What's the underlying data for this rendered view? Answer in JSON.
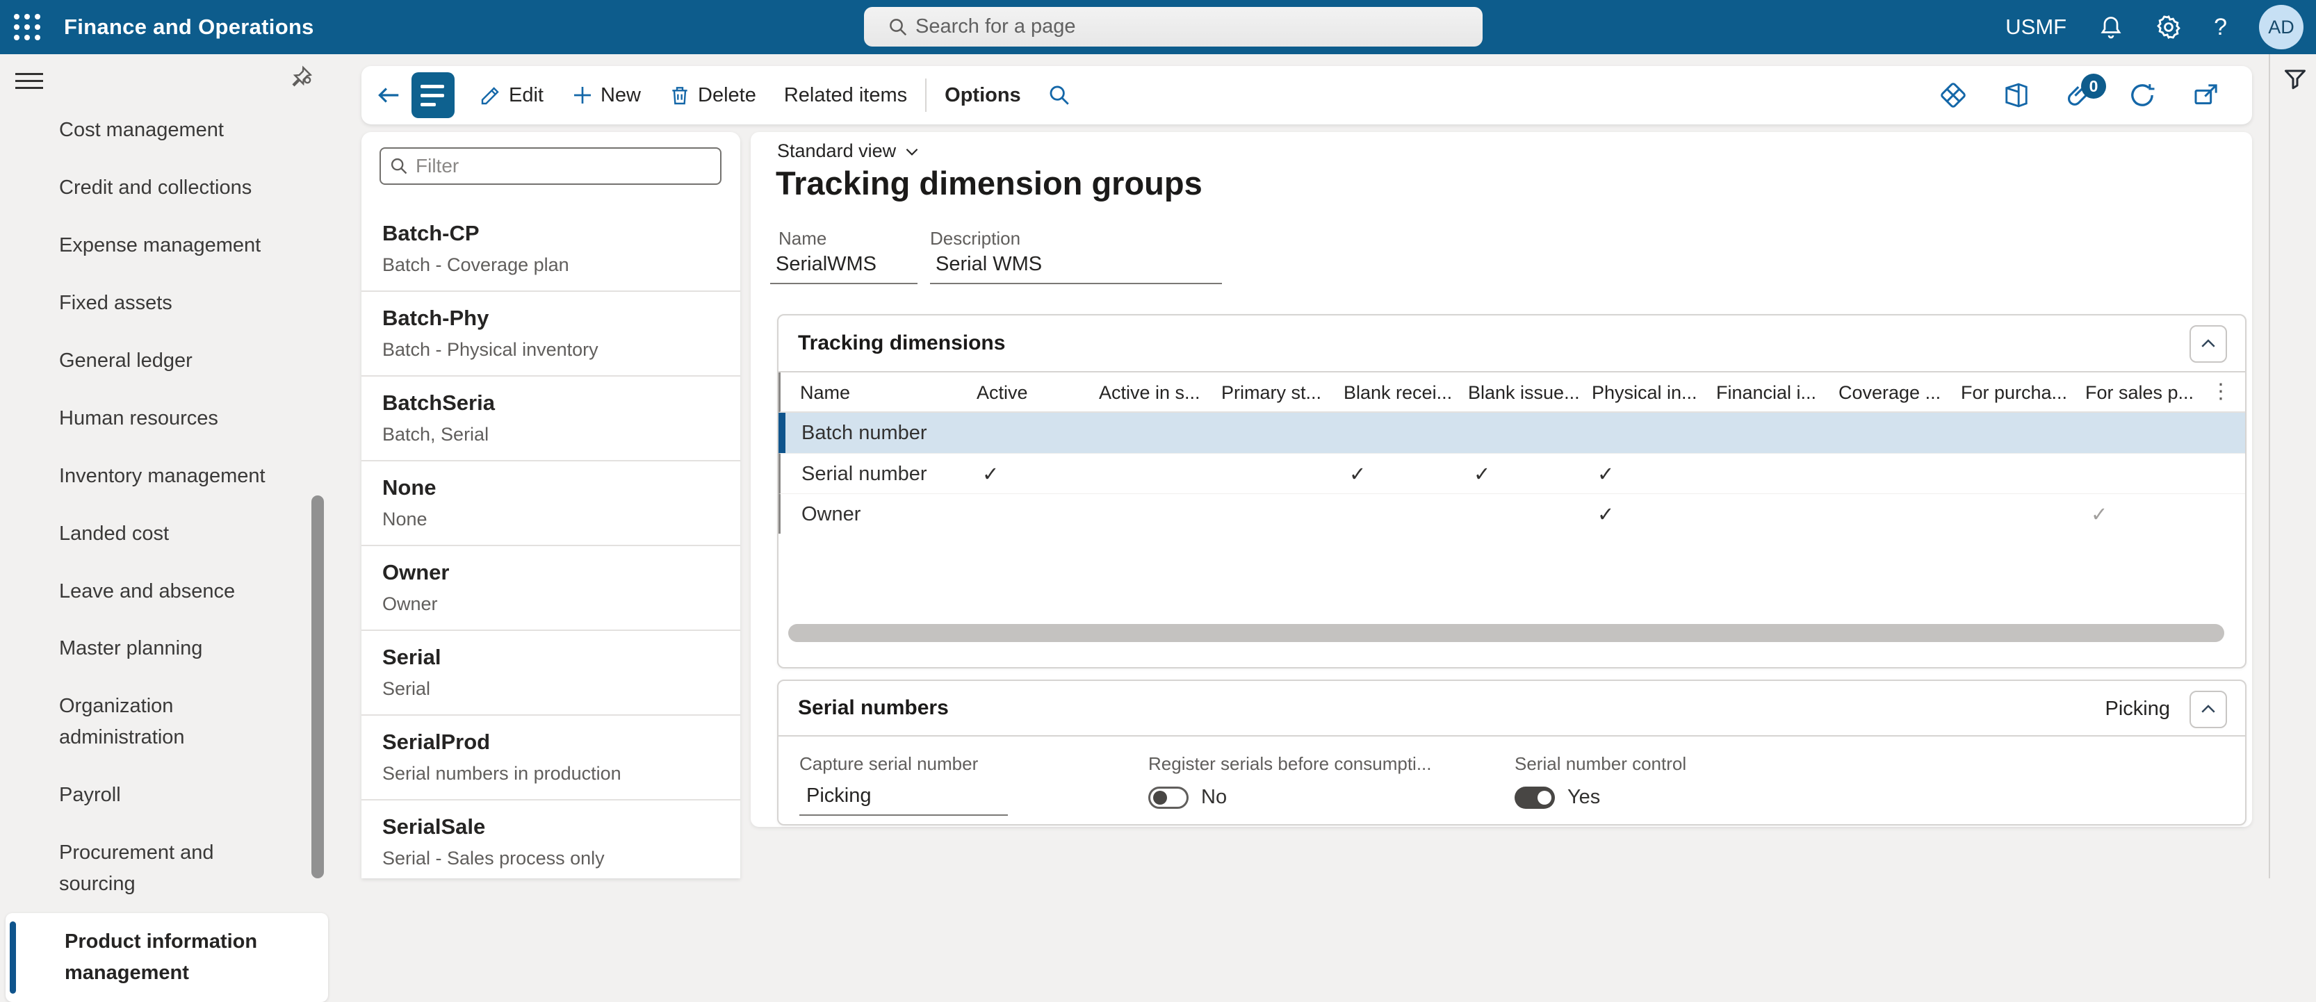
{
  "colors": {
    "topbar": "#0d5c8c",
    "accent": "#1467a8",
    "selected_row_bg": "#d3e2ee",
    "selected_row_bar": "#0f548c"
  },
  "topbar": {
    "app_title": "Finance and Operations",
    "search_placeholder": "Search for a page",
    "company": "USMF",
    "avatar_initials": "AD"
  },
  "action_bar": {
    "edit_label": "Edit",
    "new_label": "New",
    "delete_label": "Delete",
    "related_items_label": "Related items",
    "options_label": "Options",
    "attachments_badge": "0"
  },
  "nav": {
    "items": [
      {
        "label": "Cost management",
        "selected": false
      },
      {
        "label": "Credit and collections",
        "selected": false
      },
      {
        "label": "Expense management",
        "selected": false
      },
      {
        "label": "Fixed assets",
        "selected": false
      },
      {
        "label": "General ledger",
        "selected": false
      },
      {
        "label": "Human resources",
        "selected": false
      },
      {
        "label": "Inventory management",
        "selected": false
      },
      {
        "label": "Landed cost",
        "selected": false
      },
      {
        "label": "Leave and absence",
        "selected": false
      },
      {
        "label": "Master planning",
        "selected": false
      },
      {
        "label": "Organization administration",
        "selected": false
      },
      {
        "label": "Payroll",
        "selected": false
      },
      {
        "label": "Procurement and sourcing",
        "selected": false
      },
      {
        "label": "Product information management",
        "selected": true
      }
    ]
  },
  "record_list": {
    "filter_placeholder": "Filter",
    "items": [
      {
        "name": "Batch-CP",
        "description": "Batch - Coverage plan"
      },
      {
        "name": "Batch-Phy",
        "description": "Batch - Physical inventory"
      },
      {
        "name": "BatchSeria",
        "description": "Batch, Serial"
      },
      {
        "name": "None",
        "description": "None"
      },
      {
        "name": "Owner",
        "description": "Owner"
      },
      {
        "name": "Serial",
        "description": "Serial"
      },
      {
        "name": "SerialProd",
        "description": "Serial numbers in production"
      },
      {
        "name": "SerialSale",
        "description": "Serial - Sales process only"
      }
    ]
  },
  "page": {
    "view_selector": "Standard view",
    "title": "Tracking dimension groups",
    "name_label": "Name",
    "name_value": "SerialWMS",
    "description_label": "Description",
    "description_value": "Serial WMS"
  },
  "tracking_dimensions": {
    "section_title": "Tracking dimensions",
    "columns": [
      "Name",
      "Active",
      "Active in s...",
      "Primary st...",
      "Blank recei...",
      "Blank issue...",
      "Physical in...",
      "Financial i...",
      "Coverage ...",
      "For purcha...",
      "For sales p..."
    ],
    "overflow_menu": "⋮",
    "check_glyph": "✓",
    "rows": [
      {
        "name": "Batch number",
        "selected": true,
        "checks": []
      },
      {
        "name": "Serial number",
        "selected": false,
        "checks": [
          {
            "col": 1
          },
          {
            "col": 4
          },
          {
            "col": 5
          },
          {
            "col": 6
          }
        ]
      },
      {
        "name": "Owner",
        "selected": false,
        "checks": [
          {
            "col": 6
          },
          {
            "col": 10,
            "muted": true
          }
        ]
      }
    ]
  },
  "serial_numbers": {
    "section_title": "Serial numbers",
    "summary": "Picking",
    "capture_label": "Capture serial number",
    "capture_value": "Picking",
    "register_label": "Register serials before consumpti...",
    "register_value": "No",
    "register_on": false,
    "control_label": "Serial number control",
    "control_value": "Yes",
    "control_on": true
  }
}
